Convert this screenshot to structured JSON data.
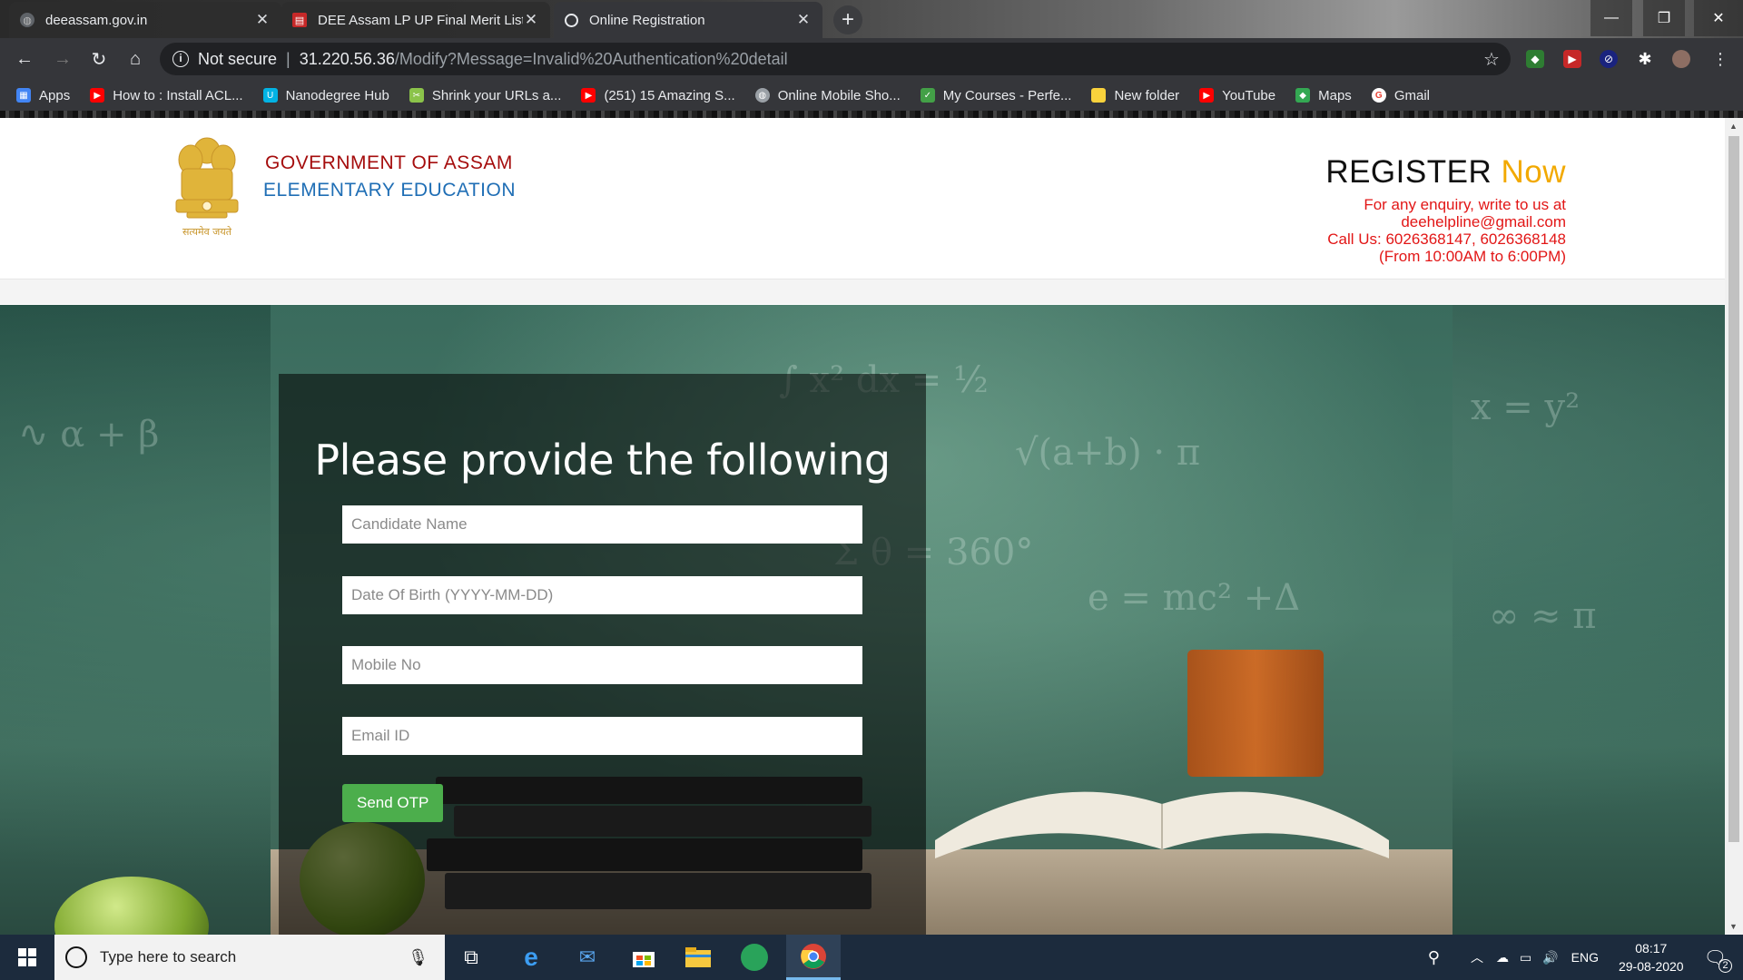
{
  "browser": {
    "tabs": [
      {
        "title": "deeassam.gov.in",
        "icon": "globe-icon"
      },
      {
        "title": "DEE Assam LP UP Final Merit List",
        "icon": "pdf-icon"
      },
      {
        "title": "Online Registration",
        "icon": "globe-icon"
      }
    ],
    "security_label": "Not secure",
    "url_host": "31.220.56.36",
    "url_path": "/Modify?Message=Invalid%20Authentication%20detail",
    "bookmarks": [
      {
        "label": "Apps",
        "icon": "apps-grid-icon",
        "color": "#4285f4"
      },
      {
        "label": "How to : Install ACL...",
        "icon": "youtube-icon",
        "color": "#ff0000"
      },
      {
        "label": "Nanodegree Hub",
        "icon": "udacity-icon",
        "color": "#02b3e4"
      },
      {
        "label": "Shrink your URLs a...",
        "icon": "shrink-icon",
        "color": "#8bc34a"
      },
      {
        "label": "(251) 15 Amazing S...",
        "icon": "youtube-icon",
        "color": "#ff0000"
      },
      {
        "label": "Online Mobile Sho...",
        "icon": "globe-icon",
        "color": "#9aa0a6"
      },
      {
        "label": "My Courses - Perfe...",
        "icon": "course-icon",
        "color": "#43a047"
      },
      {
        "label": "New folder",
        "icon": "folder-icon",
        "color": "#f9d23c"
      },
      {
        "label": "YouTube",
        "icon": "youtube-icon",
        "color": "#ff0000"
      },
      {
        "label": "Maps",
        "icon": "maps-icon",
        "color": "#34a853"
      },
      {
        "label": "Gmail",
        "icon": "google-icon",
        "color": "#ea4335"
      }
    ]
  },
  "header": {
    "emblem_caption": "सत्यमेव जयते",
    "gov_line1": "GOVERNMENT OF ASSAM",
    "gov_line2": "ELEMENTARY EDUCATION",
    "register_word": "REGISTER",
    "register_now": "Now",
    "enquiry_line": "For any enquiry, write to us at",
    "email": "deehelpline@gmail.com",
    "call_line": "Call Us: 6026368147, 6026368148",
    "hours_line": "(From 10:00AM to 6:00PM)"
  },
  "form": {
    "title": "Please provide the following",
    "fields": [
      {
        "placeholder": "Candidate Name",
        "value": ""
      },
      {
        "placeholder": "Date Of Birth (YYYY-MM-DD)",
        "value": ""
      },
      {
        "placeholder": "Mobile No",
        "value": ""
      },
      {
        "placeholder": "Email ID",
        "value": ""
      }
    ],
    "submit_label": "Send OTP"
  },
  "taskbar": {
    "search_placeholder": "Type here to search",
    "language": "ENG",
    "time": "08:17",
    "date": "29-08-2020",
    "notification_count": "2"
  },
  "colors": {
    "gov_red": "#a50d0d",
    "edu_blue": "#1f6eb5",
    "accent_orange": "#f2a900",
    "info_red": "#e21616",
    "button_green": "#4cae4c"
  }
}
